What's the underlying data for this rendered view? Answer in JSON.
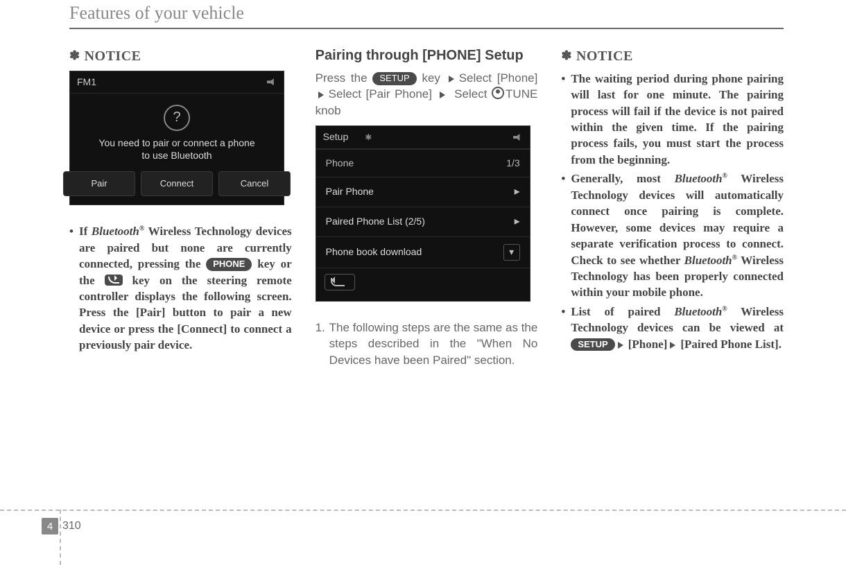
{
  "header": {
    "title": "Features of your vehicle"
  },
  "col1": {
    "notice": "NOTICE",
    "shot": {
      "fm": "FM1",
      "question": "?",
      "line1": "You need to pair or connect a phone",
      "line2": "to use Bluetooth",
      "btn_pair": "Pair",
      "btn_connect": "Connect",
      "btn_cancel": "Cancel"
    },
    "bullet_pre": "If ",
    "brand": "Bluetooth",
    "reg": "®",
    "bullet_mid1": "  Wireless Technology devices are paired but none are currently connected, pressing the ",
    "key_phone": "PHONE",
    "bullet_mid2": " key or the ",
    "bullet_mid3": " key on the steering remote controller displays the following screen. Press the [Pair] button to pair a new device or press the [Connect] to connect a previously pair device."
  },
  "col2": {
    "heading": "Pairing through [PHONE] Setup",
    "p1a": "Press the ",
    "key_setup": "SETUP",
    "p1b": " key ",
    "p1c": "Select [Phone]",
    "p1d": "Select [Pair Phone] ",
    "p1e": " Select ",
    "p1f": "TUNE knob",
    "shot": {
      "title": "Setup",
      "row_phone": "Phone",
      "row_phone_right": "1/3",
      "row_pair": "Pair Phone",
      "row_list": "Paired Phone List  (2/5)",
      "row_dl": "Phone book download"
    },
    "step1": "The following steps are the same as the steps described in the \"When No Devices have been Paired\" section.",
    "step1_n": "1."
  },
  "col3": {
    "notice": "NOTICE",
    "b1": "The waiting period during phone pairing will last for one minute. The pairing process will fail if the device is not paired within the given time. If the pairing process fails, you must start the process from the beginning.",
    "b2a": "Generally, most ",
    "b2b": " Wireless Technology devices will automatically connect once pairing is complete. However, some devices may require a separate verification process to connect. Check to see whether ",
    "b2c": " Wireless Technology has been properly connected within your mobile phone.",
    "b3a": "List of paired ",
    "b3b": "  Wireless Technology devices can be viewed at ",
    "b3c": "[Phone]",
    "b3d": "[Paired Phone List]."
  },
  "footer": {
    "chapter": "4",
    "page": "310"
  }
}
